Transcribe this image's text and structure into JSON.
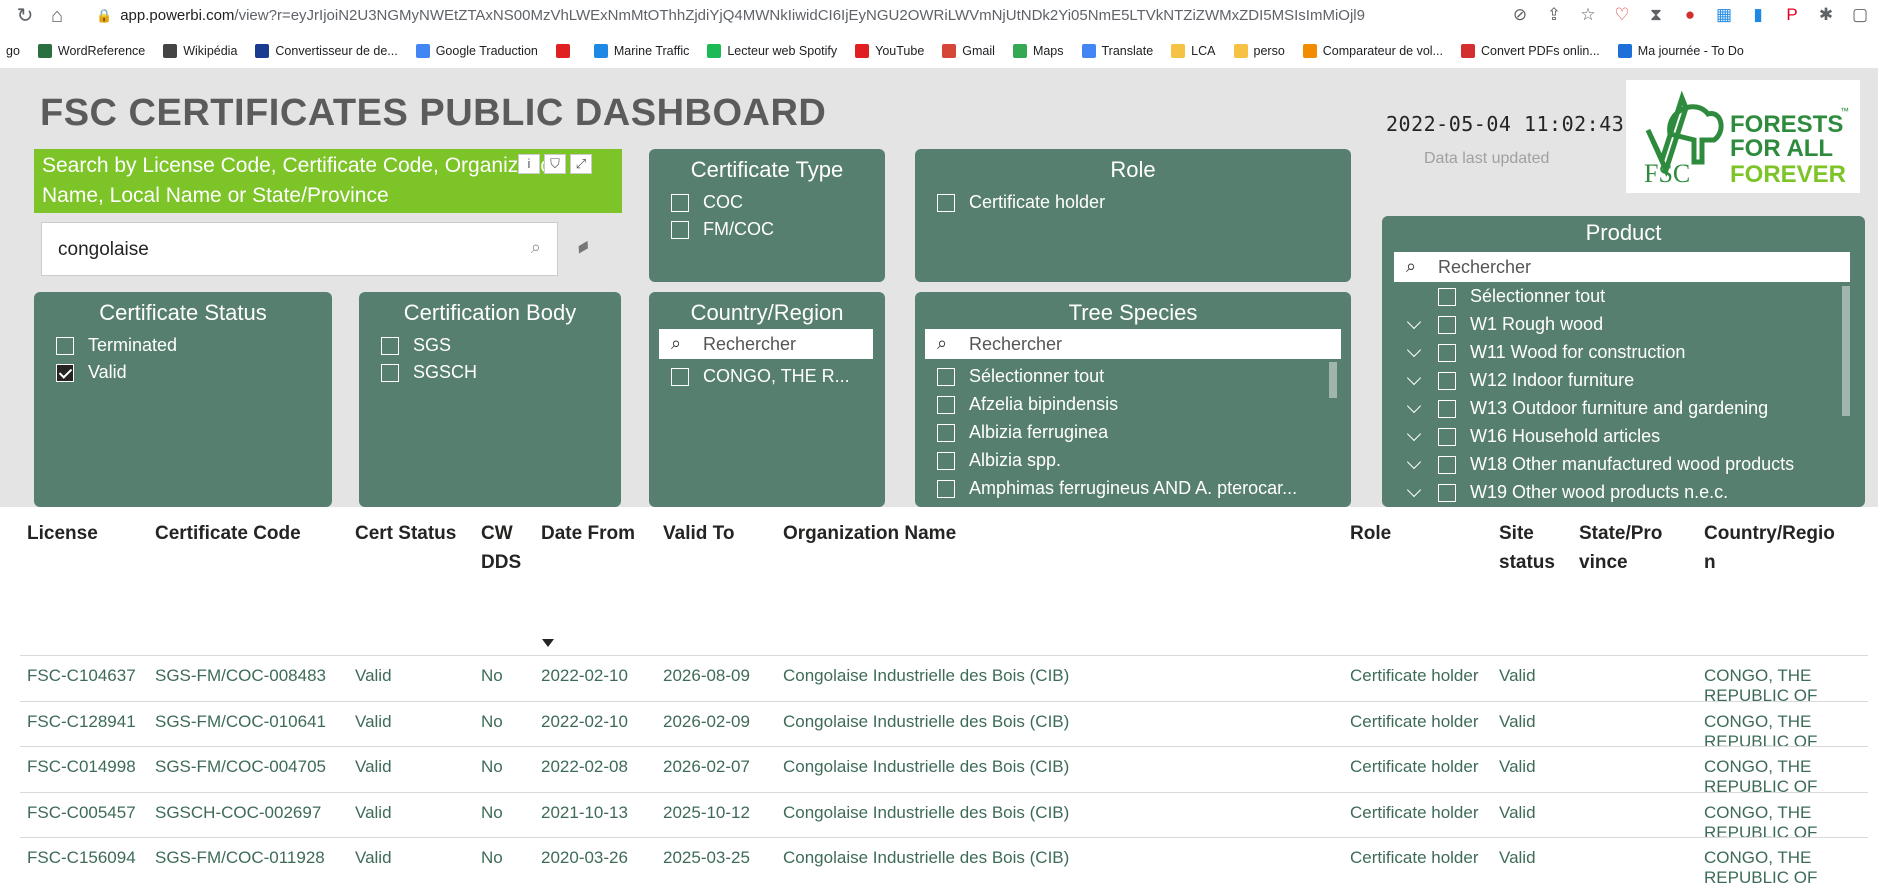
{
  "browser": {
    "url_domain": "app.powerbi.com",
    "url_path": "/view?r=eyJrIjoiN2U3NGMyNWEtZTAxNS00MzVhLWExNmMtOThhZjdiYjQ4MWNkIiwidCI6IjEyNGU2OWRiLWVmNjUtNDk2Yi05NmE5LTVkNTZiZWMxZDI5MSIsImMiOjl9",
    "bookmarks": [
      "go",
      "WordReference",
      "Wikipédia",
      "Convertisseur de de...",
      "Google Traduction",
      "",
      "Marine Traffic",
      "Lecteur web Spotify",
      "YouTube",
      "Gmail",
      "Maps",
      "Translate",
      "LCA",
      "perso",
      "Comparateur de vol...",
      "Convert PDFs onlin...",
      "Ma journée - To Do"
    ],
    "bookmark_colors": [
      "#ffffff",
      "#2a6f3f",
      "#444444",
      "#1a3a8f",
      "#4285f4",
      "#e02020",
      "#1e88e5",
      "#1db954",
      "#e02020",
      "#d44638",
      "#34a853",
      "#4285f4",
      "#f6c244",
      "#f6c244",
      "#f28b00",
      "#d32f2f",
      "#1e6fd9"
    ]
  },
  "report": {
    "title": "FSC CERTIFICATES PUBLIC DASHBOARD",
    "datetime": "2022-05-04 11:02:43",
    "updated_label": "Data last updated",
    "logo": {
      "fsc": "FSC",
      "line1": "FORESTS",
      "line2": "FOR ALL",
      "line3": "FOREVER",
      "tm": "™"
    }
  },
  "search": {
    "title": "Search by License Code, Certificate Code, Organization Name, Local Name or State/Province",
    "value": "congolaise",
    "icon_info": "i"
  },
  "panels": {
    "certificate_type": {
      "title": "Certificate Type",
      "items": [
        "COC",
        "FM/COC"
      ]
    },
    "role": {
      "title": "Role",
      "items": [
        "Certificate holder"
      ]
    },
    "product": {
      "title": "Product",
      "search_placeholder": "Rechercher",
      "items": [
        "Sélectionner tout",
        "W1 Rough wood",
        "W11 Wood for construction",
        "W12 Indoor furniture",
        "W13 Outdoor furniture and gardening",
        "W16 Household articles",
        "W18 Other manufactured wood products",
        "W19 Other wood products n.e.c."
      ]
    },
    "certificate_status": {
      "title": "Certificate Status",
      "items": [
        "Terminated",
        "Valid"
      ],
      "checked": [
        false,
        true
      ]
    },
    "certification_body": {
      "title": "Certification Body",
      "items": [
        "SGS",
        "SGSCH"
      ]
    },
    "country_region": {
      "title": "Country/Region",
      "search_placeholder": "Rechercher",
      "items": [
        "CONGO, THE R..."
      ]
    },
    "tree_species": {
      "title": "Tree Species",
      "search_placeholder": "Rechercher",
      "items": [
        "Sélectionner tout",
        "Afzelia bipindensis",
        "Albizia ferruginea",
        "Albizia spp.",
        "Amphimas ferrugineus AND A. pterocar..."
      ]
    }
  },
  "table": {
    "headers": {
      "license": "License",
      "certificate_code": "Certificate Code",
      "cert_status": "Cert Status",
      "cw_dds_1": "CW",
      "cw_dds_2": "DDS",
      "date_from": "Date From",
      "valid_to": "Valid To",
      "organization_name": "Organization Name",
      "role": "Role",
      "site_status_1": "Site",
      "site_status_2": "status",
      "state_1": "State/Pro",
      "state_2": "vince",
      "country_1": "Country/Regio",
      "country_2": "n"
    },
    "rows": [
      {
        "license": "FSC-C104637",
        "code": "SGS-FM/COC-008483",
        "status": "Valid",
        "cw": "No",
        "from": "2022-02-10",
        "to": "2026-08-09",
        "org": "Congolaise Industrielle des Bois (CIB)",
        "role": "Certificate holder",
        "site": "Valid",
        "state": "",
        "country": "CONGO, THE REPUBLIC OF"
      },
      {
        "license": "FSC-C128941",
        "code": "SGS-FM/COC-010641",
        "status": "Valid",
        "cw": "No",
        "from": "2022-02-10",
        "to": "2026-02-09",
        "org": "Congolaise Industrielle des Bois (CIB)",
        "role": "Certificate holder",
        "site": "Valid",
        "state": "",
        "country": "CONGO, THE REPUBLIC OF"
      },
      {
        "license": "FSC-C014998",
        "code": "SGS-FM/COC-004705",
        "status": "Valid",
        "cw": "No",
        "from": "2022-02-08",
        "to": "2026-02-07",
        "org": "Congolaise Industrielle des Bois (CIB)",
        "role": "Certificate holder",
        "site": "Valid",
        "state": "",
        "country": "CONGO, THE REPUBLIC OF"
      },
      {
        "license": "FSC-C005457",
        "code": "SGSCH-COC-002697",
        "status": "Valid",
        "cw": "No",
        "from": "2021-10-13",
        "to": "2025-10-12",
        "org": "Congolaise Industrielle des Bois (CIB)",
        "role": "Certificate holder",
        "site": "Valid",
        "state": "",
        "country": "CONGO, THE REPUBLIC OF"
      },
      {
        "license": "FSC-C156094",
        "code": "SGS-FM/COC-011928",
        "status": "Valid",
        "cw": "No",
        "from": "2020-03-26",
        "to": "2025-03-25",
        "org": "Congolaise Industrielle des Bois (CIB)",
        "role": "Certificate holder",
        "site": "Valid",
        "state": "",
        "country": "CONGO, THE REPUBLIC OF"
      }
    ]
  },
  "colors": {
    "panel": "#577f6f",
    "search_banner": "#7cc427",
    "fsc_green": "#2e8b3e",
    "table_text": "#3e6b57"
  }
}
